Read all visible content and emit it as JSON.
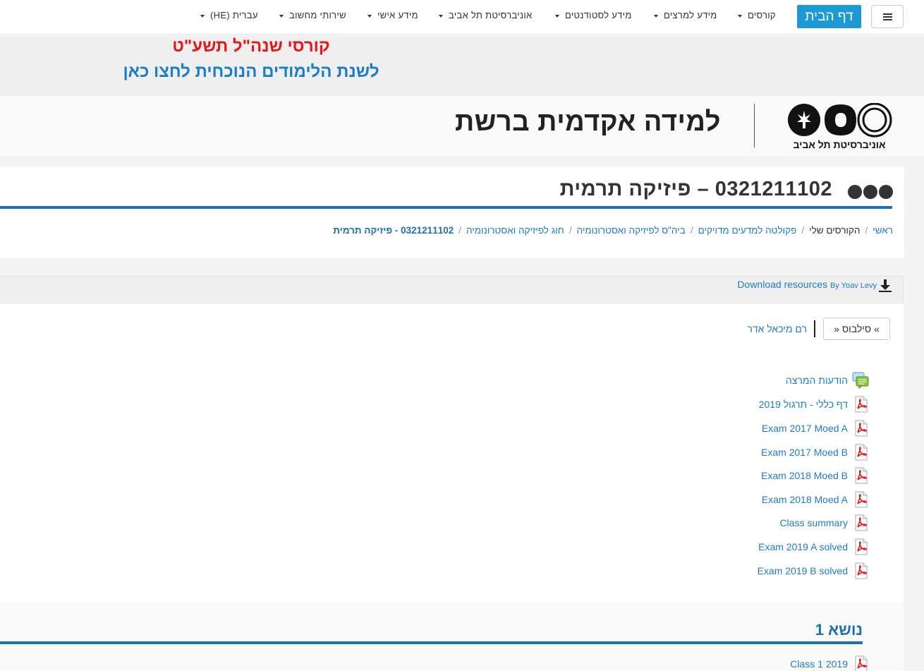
{
  "navbar": {
    "home_label": "דף הבית",
    "menu": [
      {
        "label": "קורסים"
      },
      {
        "label": "מידע למרצים"
      },
      {
        "label": "מידע לסטודנטים"
      },
      {
        "label": "אוניברסיטת תל אביב"
      },
      {
        "label": "מידע אישי"
      },
      {
        "label": "שירותי מחשוב"
      },
      {
        "label": "עברית (HE)"
      }
    ]
  },
  "banner": {
    "line1": "קורסי שנה\"ל תשע\"ט",
    "line2": "לשנת הלימודים הנוכחית לחצו כאן",
    "line1_color": "#e8151b",
    "line2_color": "#1d7cc9"
  },
  "header": {
    "site_title": "למידה אקדמית ברשת",
    "logo_text": "אוניברסיטת תל אביב"
  },
  "course": {
    "title": "0321211102 – פיזיקה תרמית",
    "breadcrumb": [
      {
        "label": "ראשי",
        "link": true
      },
      {
        "label": "הקורסים שלי",
        "link": false
      },
      {
        "label": "פקולטה למדעים מדויקים",
        "link": true
      },
      {
        "label": "ביה\"ס לפיזיקה ואסטרונומיה",
        "link": true
      },
      {
        "label": "חוג לפיזיקה ואסטרונומיה",
        "link": true
      },
      {
        "label": "0321211102 - פיזיקה תרמית",
        "link": true,
        "current": true
      }
    ],
    "download": {
      "label": "Download resources",
      "by": "By Yoav Levy"
    },
    "syllabus_button": "» סילבוס «",
    "lecturer": "רם מיכאל אדר",
    "resources": [
      {
        "label": "הודעות המרצה",
        "icon": "forum-icon"
      },
      {
        "label": "דף כללי - תרגול 2019",
        "icon": "pdf-icon"
      },
      {
        "label": "Exam 2017 Moed A",
        "icon": "pdf-icon"
      },
      {
        "label": "Exam 2017 Moed B",
        "icon": "pdf-icon"
      },
      {
        "label": "Exam 2018 Moed B",
        "icon": "pdf-icon"
      },
      {
        "label": "Exam 2018 Moed A",
        "icon": "pdf-icon"
      },
      {
        "label": "Class summary",
        "icon": "pdf-icon"
      },
      {
        "label": "Exam 2019 A solved",
        "icon": "pdf-icon"
      },
      {
        "label": "Exam 2019 B solved",
        "icon": "pdf-icon"
      }
    ],
    "section": {
      "title": "נושא 1",
      "first_item": "Class 1 2019"
    }
  },
  "colors": {
    "accent": "#1d6fb1",
    "link": "#1d7cc9",
    "home_button": "#1d9ad6"
  }
}
